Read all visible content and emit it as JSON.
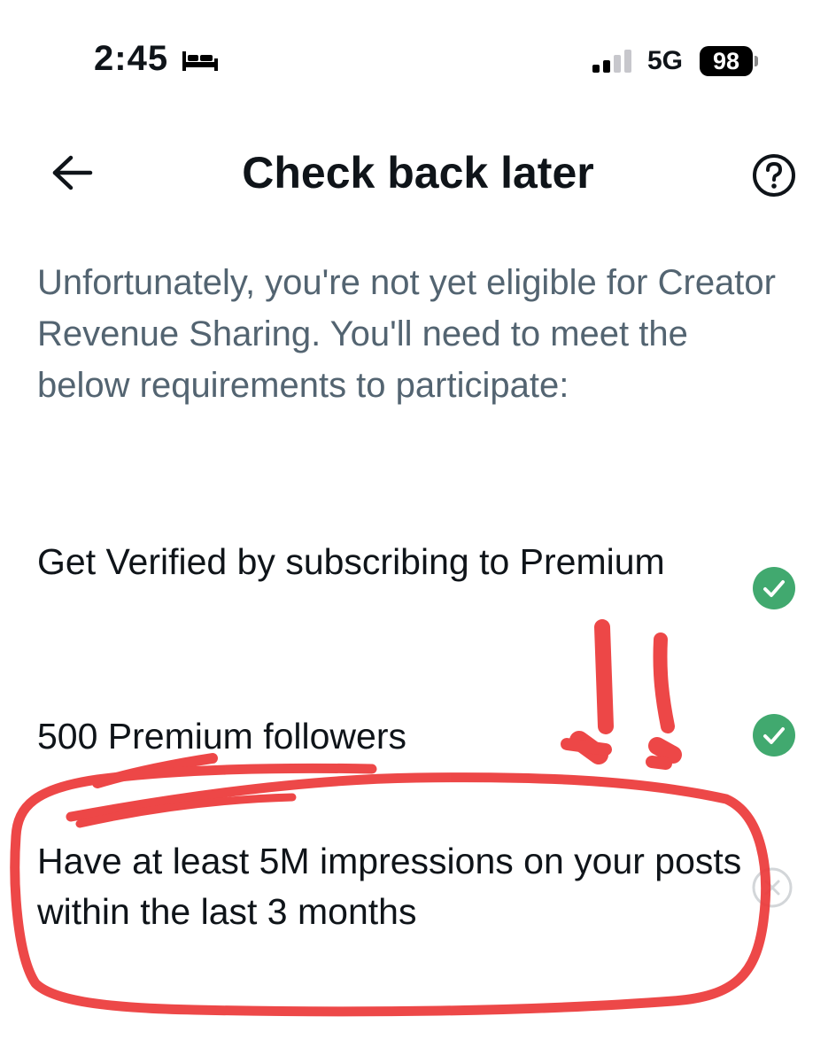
{
  "status_bar": {
    "time": "2:45",
    "network": "5G",
    "battery_level": "98",
    "icons": [
      "bed-icon",
      "signal-icon"
    ]
  },
  "header": {
    "title": "Check back later",
    "icons": [
      "back-arrow-icon",
      "help-icon"
    ]
  },
  "description": "Unfortunately, you're not yet eligible for Creator Revenue Sharing. You'll need to meet the below requirements to participate:",
  "requirements": [
    {
      "label": "Get Verified by subscribing to Premium",
      "status": "met",
      "icon": "check-circle-icon"
    },
    {
      "label": "500 Premium followers",
      "status": "met",
      "icon": "check-circle-icon"
    },
    {
      "label": "Have at least 5M impressions on your posts within the last 3 months",
      "status": "not-met",
      "icon": "x-circle-icon"
    }
  ],
  "colors": {
    "met": "#41a96f",
    "not_met": "#d3d6d9",
    "annotation": "#ec3a3a",
    "description_text": "#536471"
  }
}
